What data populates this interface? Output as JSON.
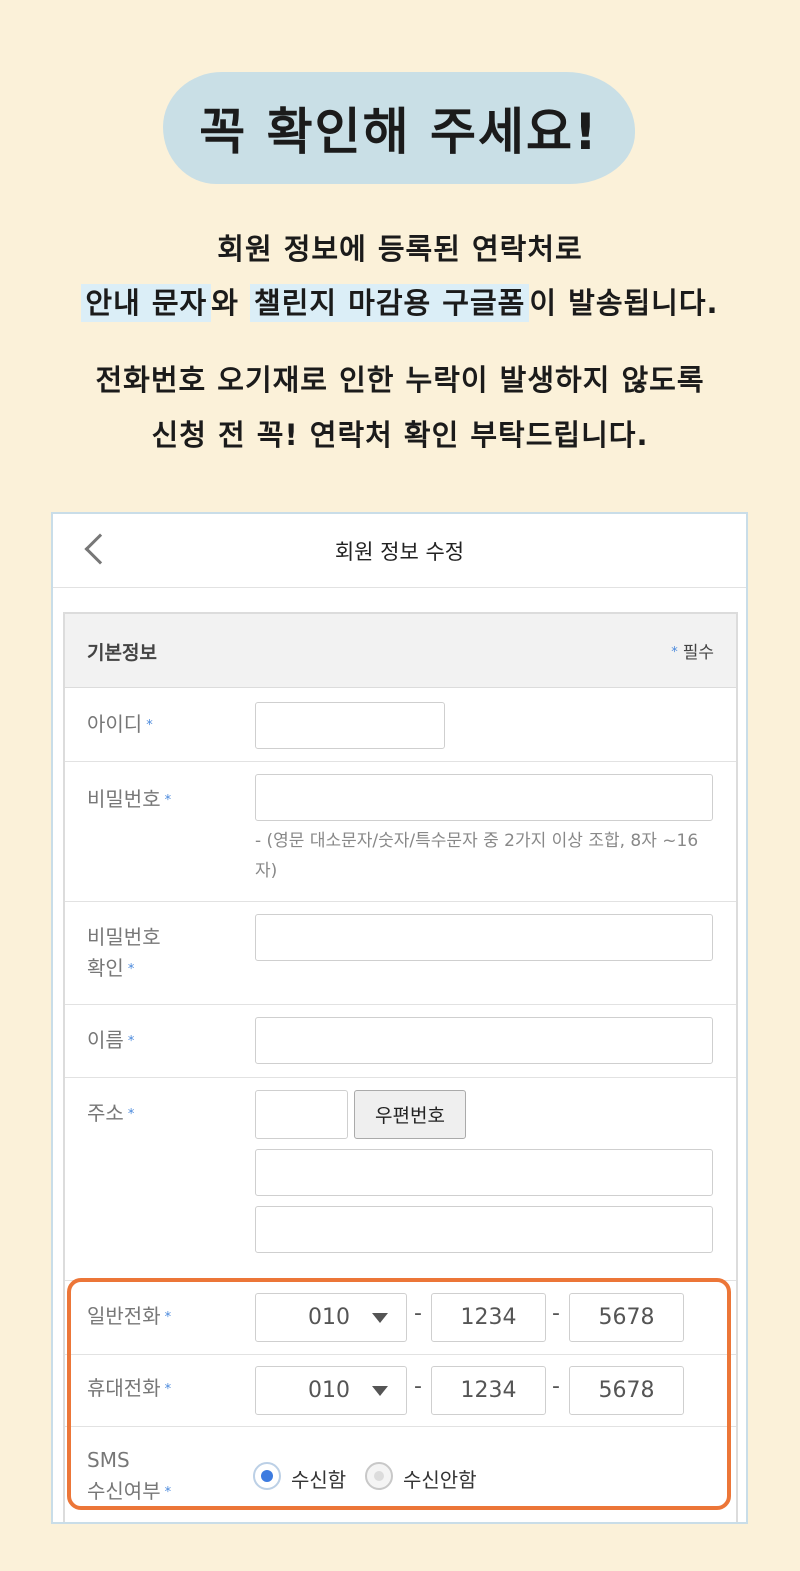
{
  "banner": {
    "title": "꼭 확인해 주세요!",
    "line1": "회원 정보에 등록된 연락처로",
    "line2_hl1": "안내 문자",
    "line2_mid": "와 ",
    "line2_hl2": "챌린지 마감용 구글폼",
    "line2_end": "이 발송됩니다.",
    "line3": "전화번호 오기재로 인한 누락이 발생하지 않도록",
    "line4": "신청 전 꼭! 연락처 확인 부탁드립니다."
  },
  "header": {
    "title": "회원 정보 수정"
  },
  "section": {
    "title": "기본정보",
    "required_note": "필수",
    "required_mark": "*"
  },
  "fields": {
    "id_label": "아이디",
    "password_label": "비밀번호",
    "password_hint": "- (영문 대소문자/숫자/특수문자 중 2가지 이상 조합, 8자 ~16자)",
    "password_confirm_label_1": "비밀번호",
    "password_confirm_label_2": "확인",
    "name_label": "이름",
    "address_label": "주소",
    "zipcode_button": "우편번호",
    "landline_label": "일반전화",
    "mobile_label": "휴대전화",
    "sms_label_1": "SMS",
    "sms_label_2": "수신여부"
  },
  "phone": {
    "landline": {
      "prefix": "010",
      "middle": "1234",
      "last": "5678"
    },
    "mobile": {
      "prefix": "010",
      "middle": "1234",
      "last": "5678"
    },
    "separator": "-"
  },
  "sms": {
    "options": [
      "수신함",
      "수신안함"
    ],
    "selected": "수신함"
  },
  "colors": {
    "background": "#fbf1d9",
    "title_blob": "#c9dfe6",
    "highlight": "#dbeef7",
    "required_star": "#4a89dc",
    "callout_border": "#ec7638",
    "radio_selected": "#3d7be0"
  }
}
